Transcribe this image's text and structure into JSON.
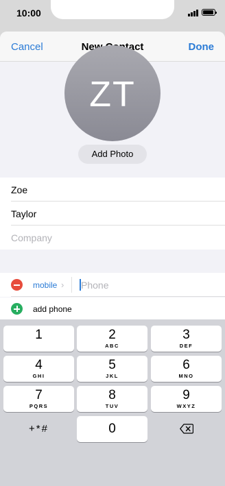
{
  "status_bar": {
    "time": "10:00",
    "icons": [
      "cellular-signal-icon",
      "battery-icon"
    ]
  },
  "nav": {
    "cancel_label": "Cancel",
    "title": "New Contact",
    "done_label": "Done"
  },
  "avatar": {
    "initials": "ZT",
    "add_photo_label": "Add Photo"
  },
  "fields": {
    "first_name": "Zoe",
    "last_name": "Taylor",
    "company_placeholder": "Company"
  },
  "phone": {
    "label": "mobile",
    "placeholder": "Phone",
    "value": "",
    "add_label": "add phone"
  },
  "colors": {
    "accent": "#2a7bd6",
    "remove": "#e74c3c",
    "add": "#27ae60"
  },
  "keypad": {
    "keys": [
      {
        "num": "1",
        "letters": ""
      },
      {
        "num": "2",
        "letters": "ABC"
      },
      {
        "num": "3",
        "letters": "DEF"
      },
      {
        "num": "4",
        "letters": "GHI"
      },
      {
        "num": "5",
        "letters": "JKL"
      },
      {
        "num": "6",
        "letters": "MNO"
      },
      {
        "num": "7",
        "letters": "PQRS"
      },
      {
        "num": "8",
        "letters": "TUV"
      },
      {
        "num": "9",
        "letters": "WXYZ"
      },
      {
        "num": "0",
        "letters": ""
      }
    ],
    "symbols_label": "+*#",
    "backspace_icon": "backspace-icon"
  }
}
